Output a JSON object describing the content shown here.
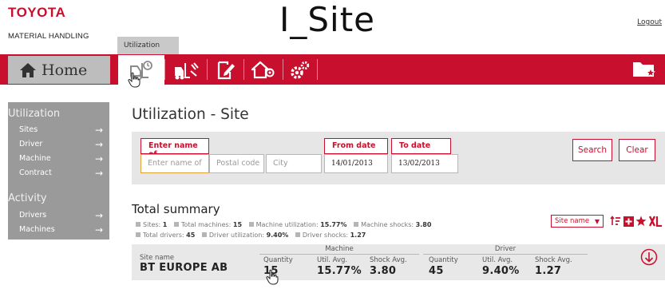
{
  "brand": {
    "company": "TOYOTA",
    "division": "MATERIAL HANDLING"
  },
  "header": {
    "app_title": "I_Site",
    "logout_label": "Logout"
  },
  "nav": {
    "active_tab_label": "Utilization",
    "home_label": "Home",
    "icons": [
      "home-icon",
      "forklift-utilization-icon",
      "forklift-shock-icon",
      "report-edit-icon",
      "home-settings-icon",
      "gears-icon",
      "folder-star-icon"
    ],
    "accent_color": "#c8102e"
  },
  "sidebar": {
    "sections": [
      {
        "heading": "Utilization",
        "items": [
          {
            "label": "Sites"
          },
          {
            "label": "Driver"
          },
          {
            "label": "Machine"
          },
          {
            "label": "Contract"
          }
        ]
      },
      {
        "heading": "Activity",
        "items": [
          {
            "label": "Drivers"
          },
          {
            "label": "Machines"
          }
        ]
      }
    ]
  },
  "page": {
    "title": "Utilization - Site"
  },
  "filters": {
    "name_label": "Enter name of",
    "name_placeholder": "Enter name of",
    "postal_placeholder": "Postal code",
    "city_placeholder": "City",
    "from_label": "From date",
    "from_value": "14/01/2013",
    "to_label": "To date",
    "to_value": "13/02/2013",
    "search_label": "Search",
    "clear_label": "Clear"
  },
  "summary": {
    "title": "Total summary",
    "sites_label": "Sites:",
    "sites_value": "1",
    "total_machines_label": "Total machines:",
    "total_machines_value": "15",
    "machine_util_label": "Machine utilization:",
    "machine_util_value": "15.77%",
    "machine_shocks_label": "Machine shocks:",
    "machine_shocks_value": "3.80",
    "total_drivers_label": "Total drivers:",
    "total_drivers_value": "45",
    "driver_util_label": "Driver utilization:",
    "driver_util_value": "9.40%",
    "driver_shocks_label": "Driver shocks:",
    "driver_shocks_value": "1.27"
  },
  "sort": {
    "selected": "Site name"
  },
  "table": {
    "site_name_header": "Site name",
    "machine_group": "Machine",
    "driver_group": "Driver",
    "quantity_header": "Quantity",
    "util_avg_header": "Util. Avg.",
    "shock_avg_header": "Shock Avg.",
    "row": {
      "site_name": "BT EUROPE AB",
      "machine_quantity": "15",
      "machine_util": "15.77%",
      "machine_shock": "3.80",
      "driver_quantity": "45",
      "driver_util": "9.40%",
      "driver_shock": "1.27"
    }
  }
}
